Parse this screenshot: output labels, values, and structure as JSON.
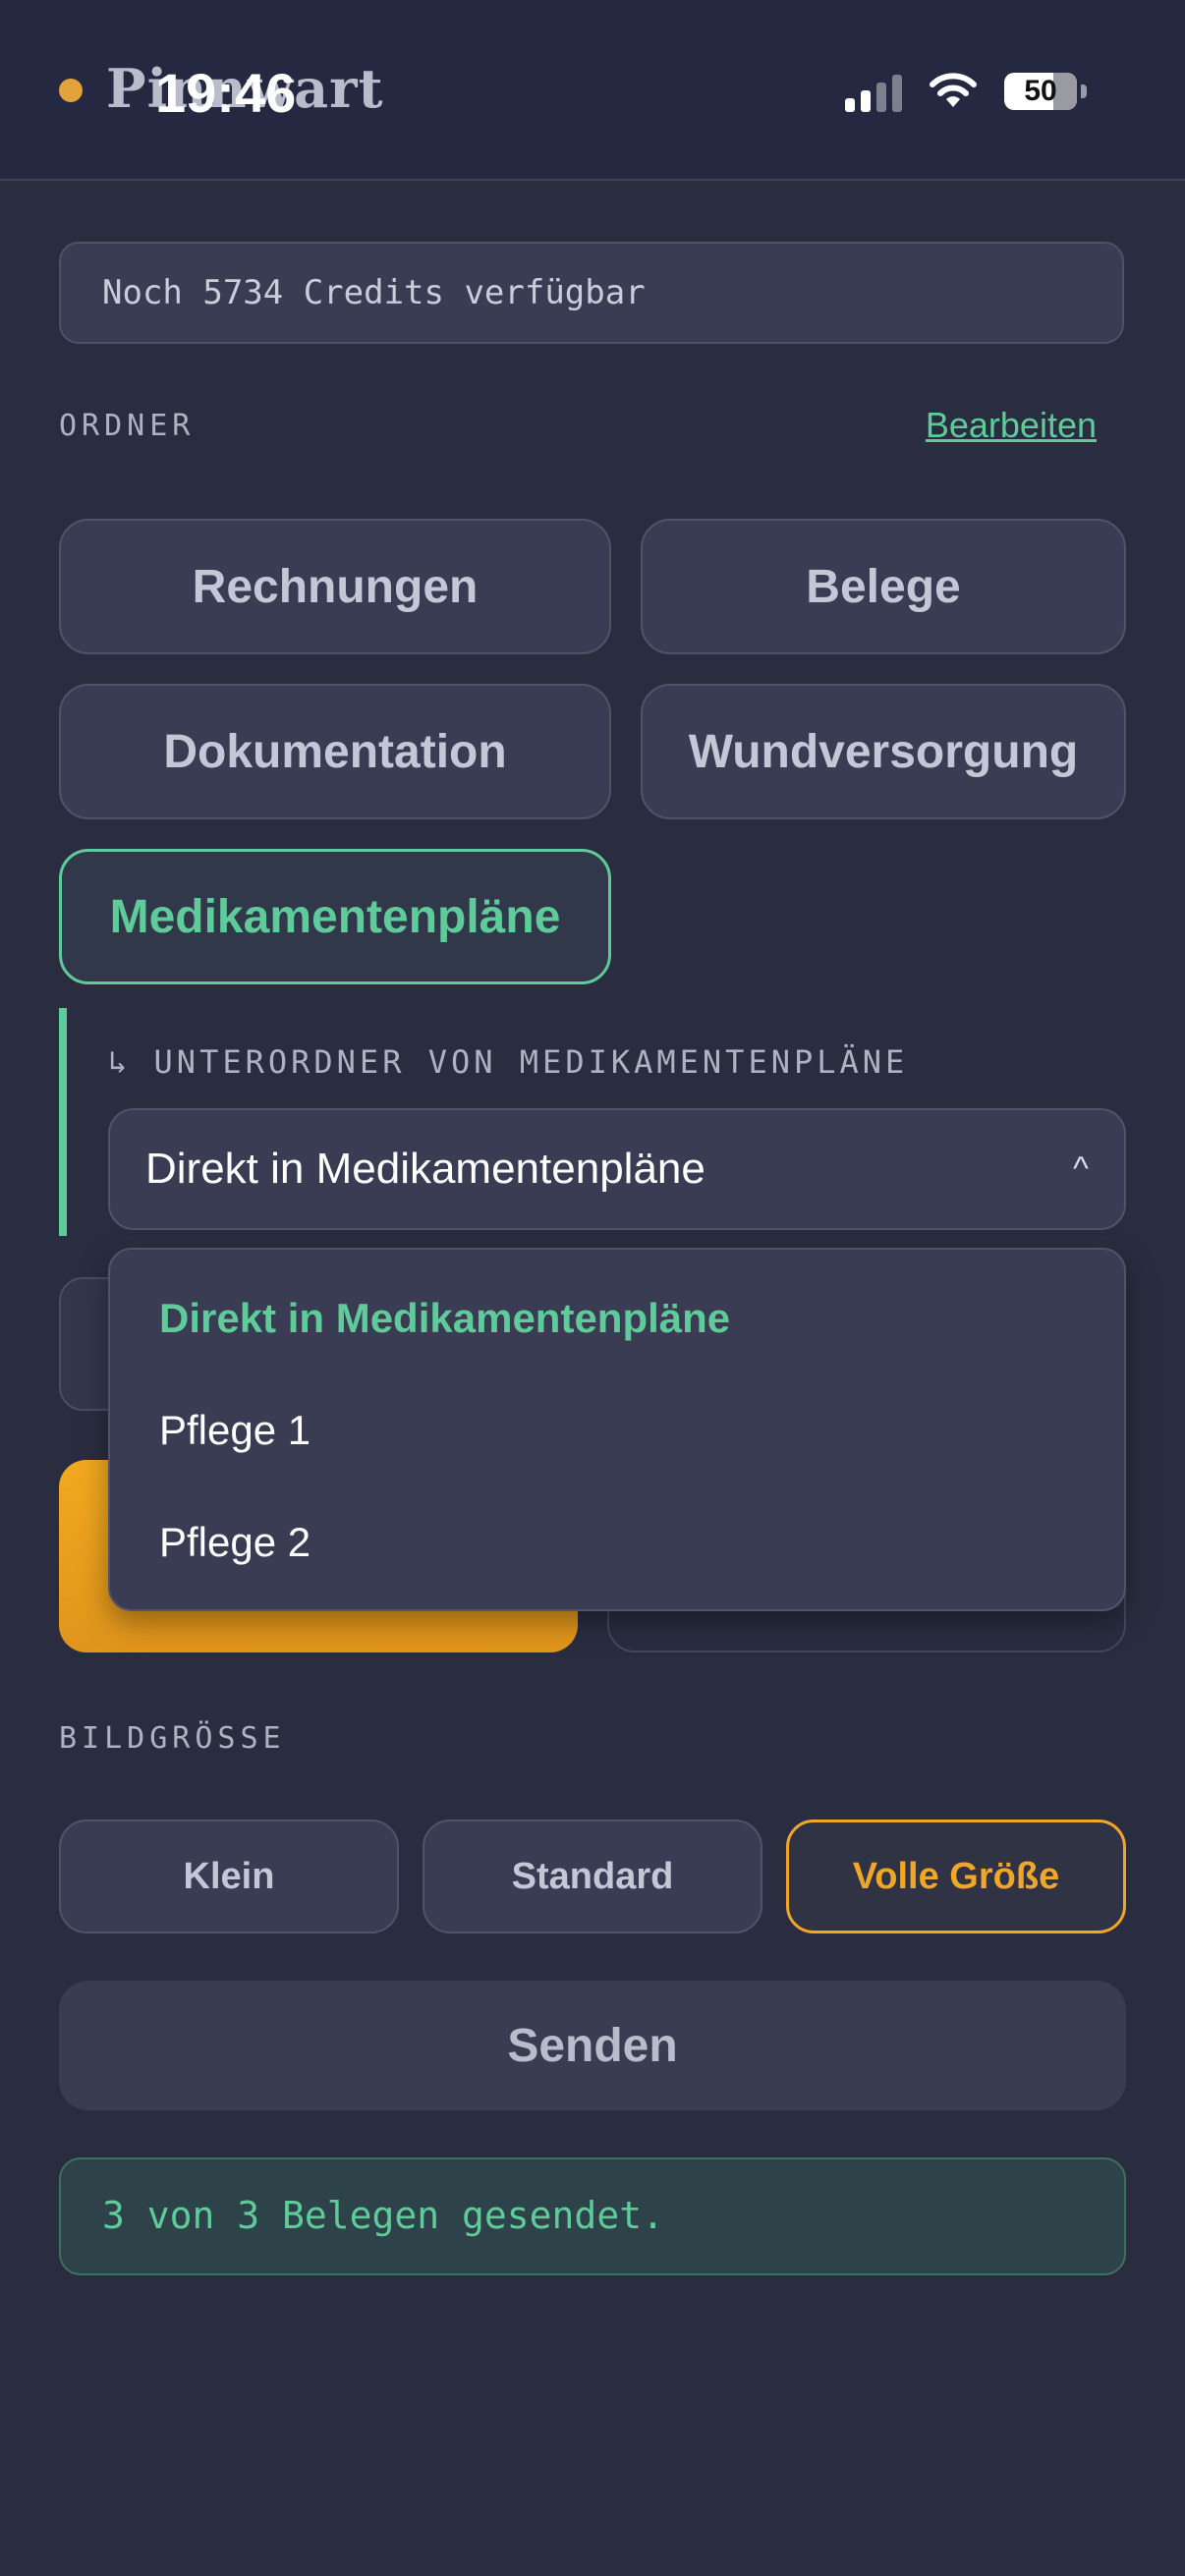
{
  "header": {
    "app_title": "Pinnwart",
    "clock": "19:46",
    "battery_level": "50",
    "status_dot_color": "#e3a23a"
  },
  "credits_text": "Noch 5734 Credits verfügbar",
  "folders_section": {
    "label": "ORDNER",
    "edit_link": "Bearbeiten",
    "folders": [
      {
        "label": "Rechnungen",
        "active": false
      },
      {
        "label": "Belege",
        "active": false
      },
      {
        "label": "Dokumentation",
        "active": false
      },
      {
        "label": "Wundversorgung",
        "active": false
      },
      {
        "label": "Medikamentenpläne",
        "active": true
      }
    ]
  },
  "subfolder": {
    "label": "↳ UNTERORDNER VON MEDIKAMENTENPLÄNE",
    "selected": "Direkt in Medikamentenpläne",
    "caret": "^",
    "options": [
      {
        "label": "Direkt in Medikamentenpläne",
        "selected": true
      },
      {
        "label": "Pflege 1",
        "selected": false
      },
      {
        "label": "Pflege 2",
        "selected": false
      }
    ]
  },
  "image_size": {
    "label": "BILDGRÖSSE",
    "options": [
      {
        "label": "Klein",
        "active": false
      },
      {
        "label": "Standard",
        "active": false
      },
      {
        "label": "Volle Größe",
        "active": true
      }
    ]
  },
  "send_button": "Senden",
  "success_message": "3 von 3 Belegen gesendet.",
  "colors": {
    "accent_green": "#5fcb9a",
    "accent_orange": "#f0a727",
    "background": "#292d3f"
  }
}
